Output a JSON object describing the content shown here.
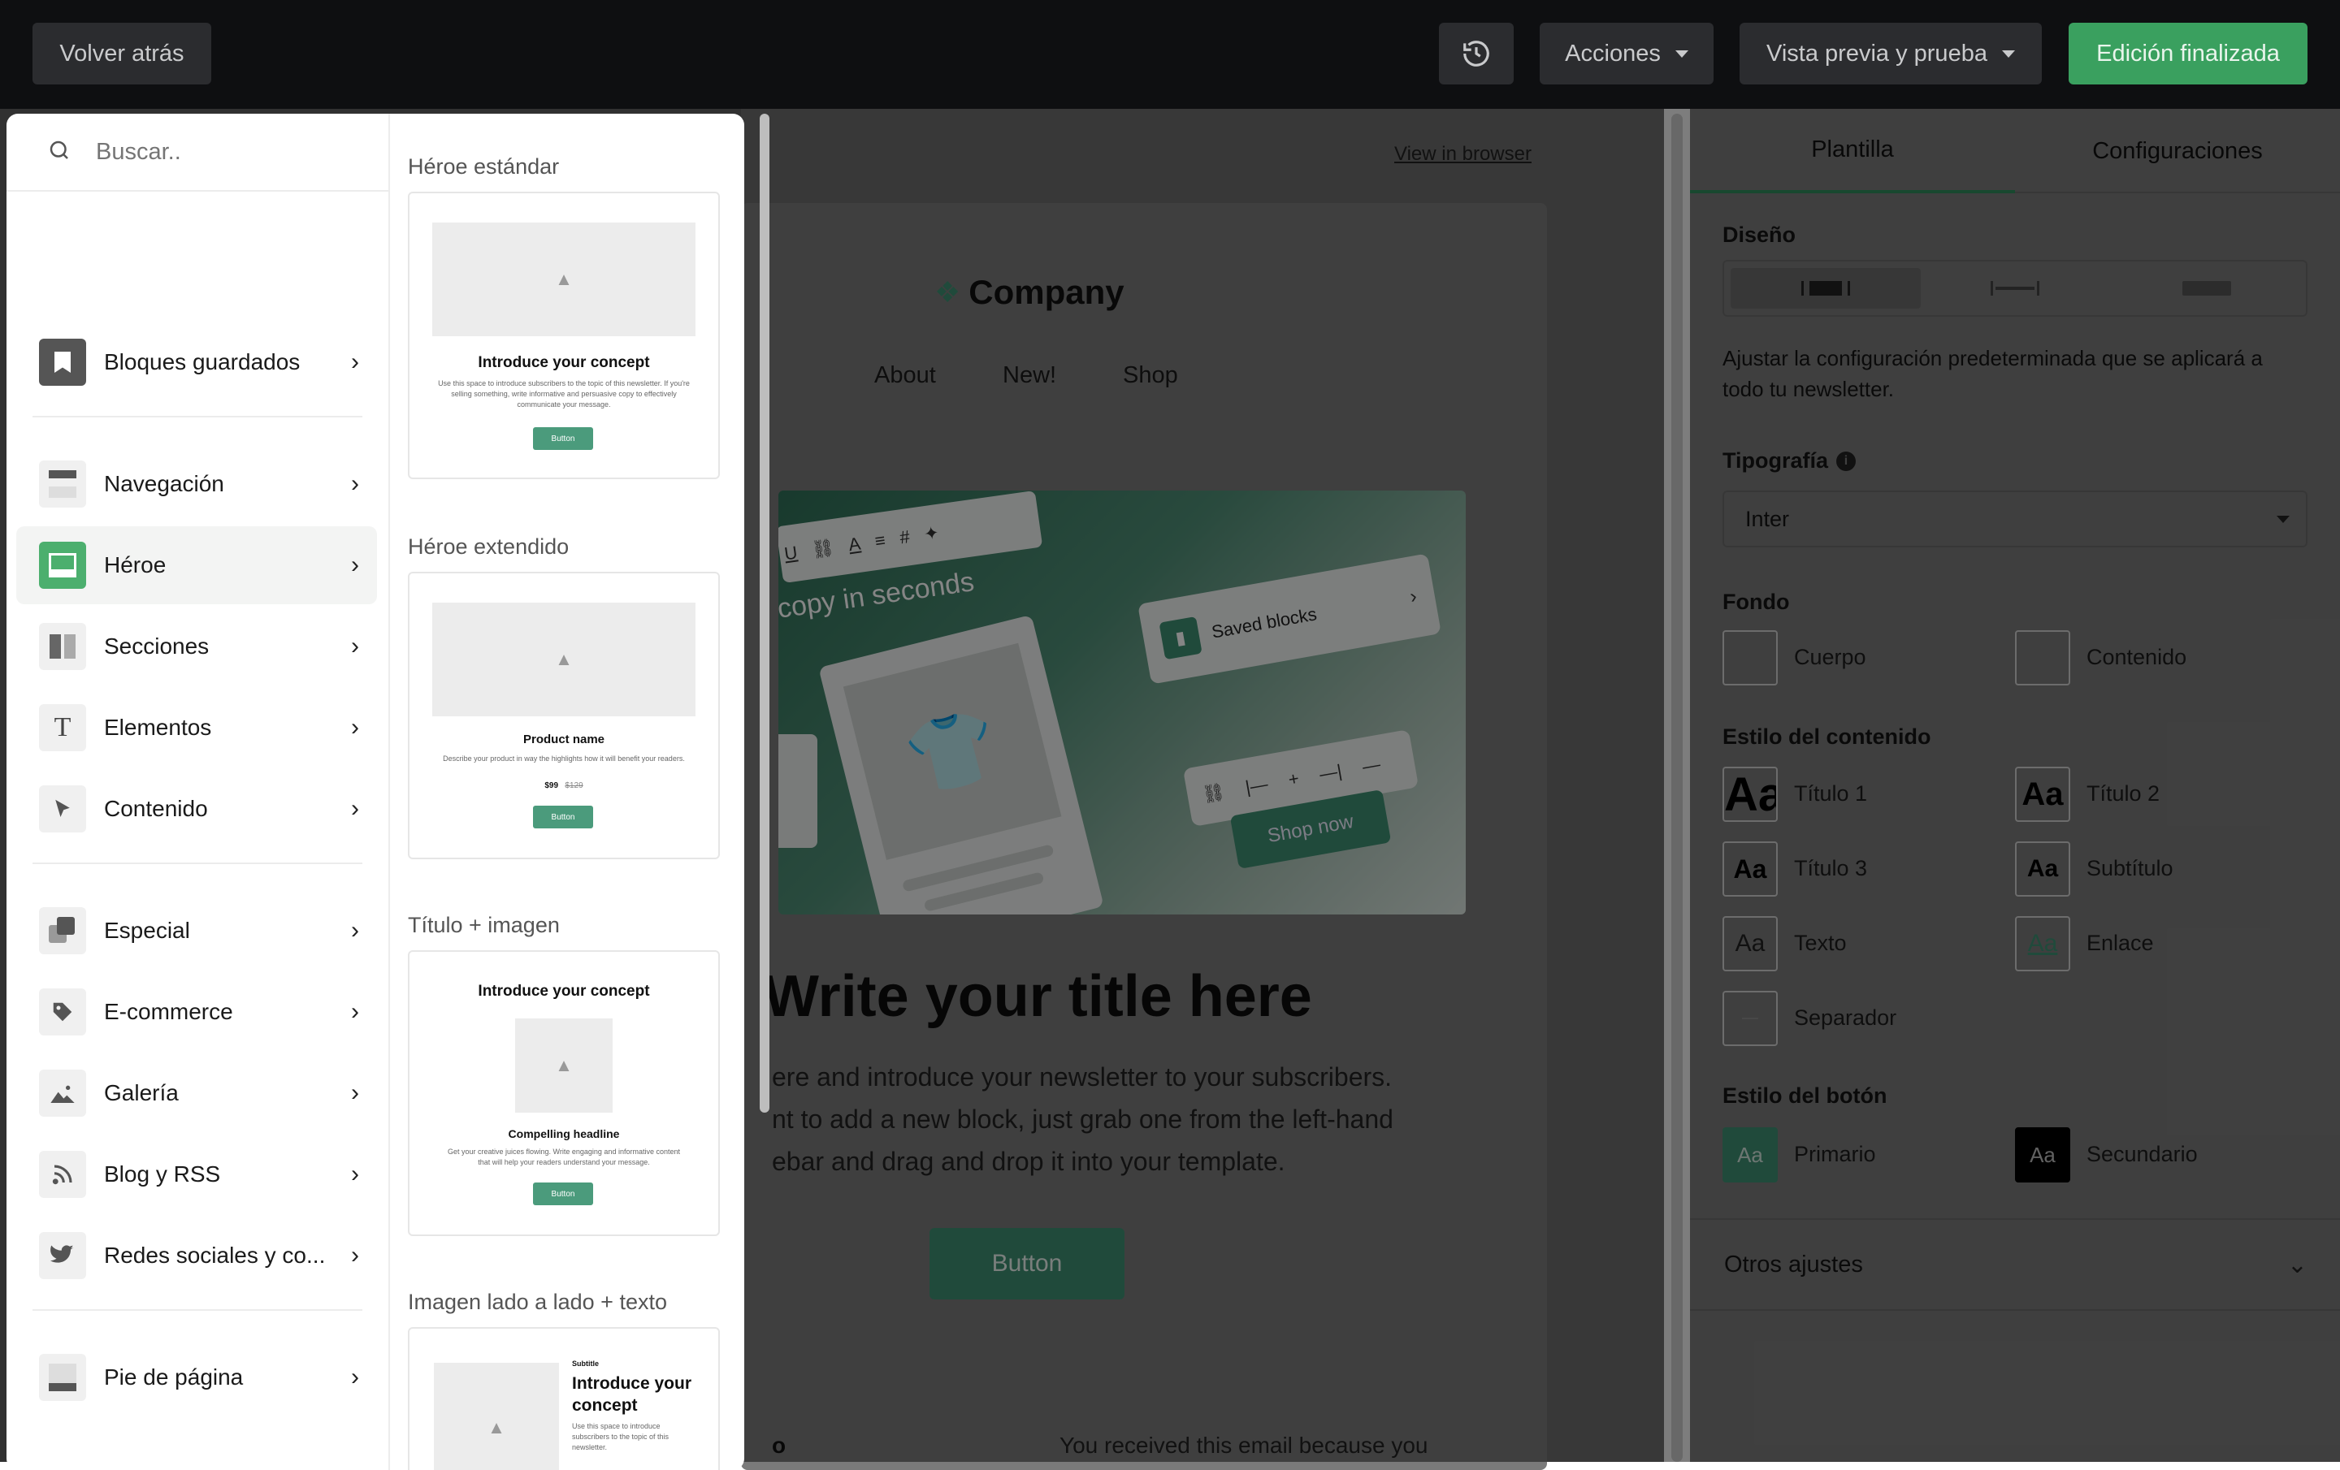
{
  "topbar": {
    "back_label": "Volver atrás",
    "history_icon": "history-icon",
    "actions_label": "Acciones",
    "preview_label": "Vista previa y prueba",
    "done_label": "Edición finalizada",
    "done_color": "#3aa05f"
  },
  "left_panel": {
    "search_placeholder": "Buscar..",
    "groups": [
      {
        "label": "Bloques guardados",
        "icon": "bookmark-icon"
      },
      {
        "label": "Navegación",
        "icon": "navigation-icon"
      },
      {
        "label": "Héroe",
        "icon": "hero-icon"
      },
      {
        "label": "Secciones",
        "icon": "sections-icon"
      },
      {
        "label": "Elementos",
        "icon": "text-icon"
      },
      {
        "label": "Contenido",
        "icon": "cursor-icon"
      },
      {
        "label": "Especial",
        "icon": "special-icon"
      },
      {
        "label": "E-commerce",
        "icon": "tag-icon"
      },
      {
        "label": "Galería",
        "icon": "gallery-icon"
      },
      {
        "label": "Blog y RSS",
        "icon": "rss-icon"
      },
      {
        "label": "Redes sociales y co...",
        "icon": "twitter-icon"
      },
      {
        "label": "Pie de página",
        "icon": "footer-icon"
      }
    ],
    "active_group": "Héroe",
    "accent": "#4caf6e"
  },
  "blocks": [
    {
      "label": "Héroe estándar",
      "title": "Introduce your concept",
      "body": "Use this space to introduce subscribers to the topic of this newsletter. If you're selling something, write informative and persuasive copy to effectively communicate your message.",
      "button": "Button"
    },
    {
      "label": "Héroe extendido",
      "title": "Product name",
      "body": "Describe your product in way the highlights how it will benefit your readers.",
      "price": "$99",
      "old_price": "$129",
      "button": "Button"
    },
    {
      "label": "Título + imagen",
      "title": "Introduce your concept",
      "subtitle": "Compelling headline",
      "body": "Get your creative juices flowing. Write engaging and informative content that will help your readers understand your message.",
      "button": "Button"
    },
    {
      "label": "Imagen lado a lado + texto",
      "eyebrow": "Subtitle",
      "title": "Introduce your concept",
      "body": "Use this space to introduce subscribers to the topic of this newsletter."
    }
  ],
  "email": {
    "view_in_browser": "View in browser",
    "company": "Company",
    "nav": [
      "About",
      "New!",
      "Shop"
    ],
    "hero_image": {
      "caption": "copy in seconds",
      "saved_blocks": "Saved blocks",
      "shop_now": "Shop now"
    },
    "title": "Write your title here",
    "body_lines": [
      "ere and introduce your newsletter to your subscribers.",
      "nt to add a new block, just grab one from the left-hand",
      "ebar and drag and drop it into your template."
    ],
    "button": "Button",
    "footer_text": "You received this email because you",
    "footer_left_glyph": "o",
    "brand_color": "#3f8f72"
  },
  "right_panel": {
    "tabs": [
      "Plantilla",
      "Configuraciones"
    ],
    "active_tab": "Plantilla",
    "design_label": "Diseño",
    "design_help": "Ajustar la configuración predeterminada que se aplicará a todo tu newsletter.",
    "typography_label": "Tipografía",
    "font_value": "Inter",
    "background_label": "Fondo",
    "background": [
      "Cuerpo",
      "Contenido"
    ],
    "content_style_label": "Estilo del contenido",
    "content_styles": [
      {
        "sample": "Aa",
        "label": "Título 1"
      },
      {
        "sample": "Aa",
        "label": "Título 2"
      },
      {
        "sample": "Aa",
        "label": "Título 3"
      },
      {
        "sample": "Aa",
        "label": "Subtítulo"
      },
      {
        "sample": "Aa",
        "label": "Texto"
      },
      {
        "sample": "Aa",
        "label": "Enlace"
      },
      {
        "sample": "",
        "label": "Separador"
      }
    ],
    "button_style_label": "Estilo del botón",
    "button_styles": [
      {
        "sample": "Aa",
        "label": "Primario",
        "color": "#3f8f72"
      },
      {
        "sample": "Aa",
        "label": "Secundario",
        "color": "#000000"
      }
    ],
    "other_settings": "Otros ajustes"
  }
}
